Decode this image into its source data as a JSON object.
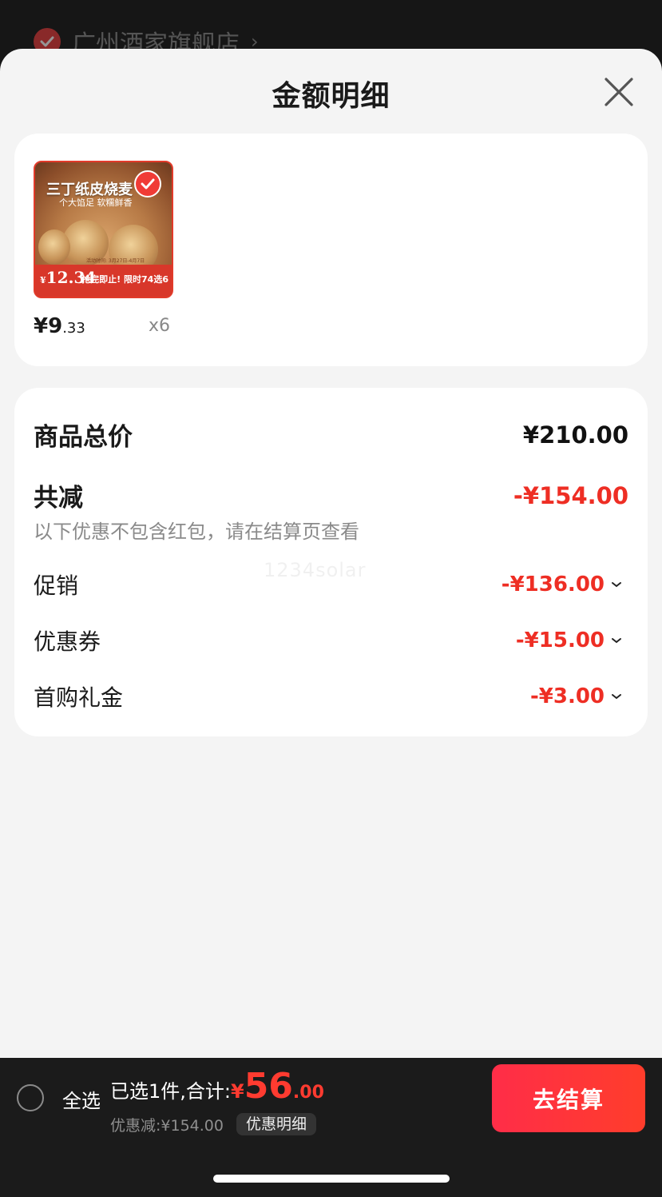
{
  "background": {
    "store_name": "广州酒家旗舰店",
    "chevron": "›"
  },
  "sheet": {
    "title": "金额明细",
    "close_icon": "close-icon"
  },
  "product": {
    "image_text": {
      "title": "三丁纸皮烧麦",
      "subtitle": "个大馅足 软糯鲜香",
      "price_symbol": "¥",
      "price": "12.34",
      "promo": "抢完即止! 限时74选6",
      "tiny": "活动时间: 3月27日-4月7日"
    },
    "selected": true,
    "price_symbol": "¥",
    "price_int": "9",
    "price_dec": ".33",
    "quantity": "x6"
  },
  "amount": {
    "total_label": "商品总价",
    "total_value": "¥210.00",
    "reduce_label": "共减",
    "reduce_value": "-¥154.00",
    "note": "以下优惠不包含红包，请在结算页查看",
    "watermark": "1234solar",
    "items": [
      {
        "label": "促销",
        "value": "-¥136.00"
      },
      {
        "label": "优惠券",
        "value": "-¥15.00"
      },
      {
        "label": "首购礼金",
        "value": "-¥3.00"
      }
    ]
  },
  "bottom_bar": {
    "select_all": "全选",
    "selected_summary": "已选1件,合计:",
    "currency": "¥",
    "total_int": "56",
    "total_dec": ".00",
    "discount_text": "优惠减:¥154.00",
    "detail_chip": "优惠明细",
    "checkout": "去结算"
  },
  "colors": {
    "accent_red": "#ee2e24",
    "checkout_gradient_start": "#ff2d48",
    "checkout_gradient_end": "#ff3d2b",
    "bottom_bar_bg": "#1b1b1b"
  }
}
